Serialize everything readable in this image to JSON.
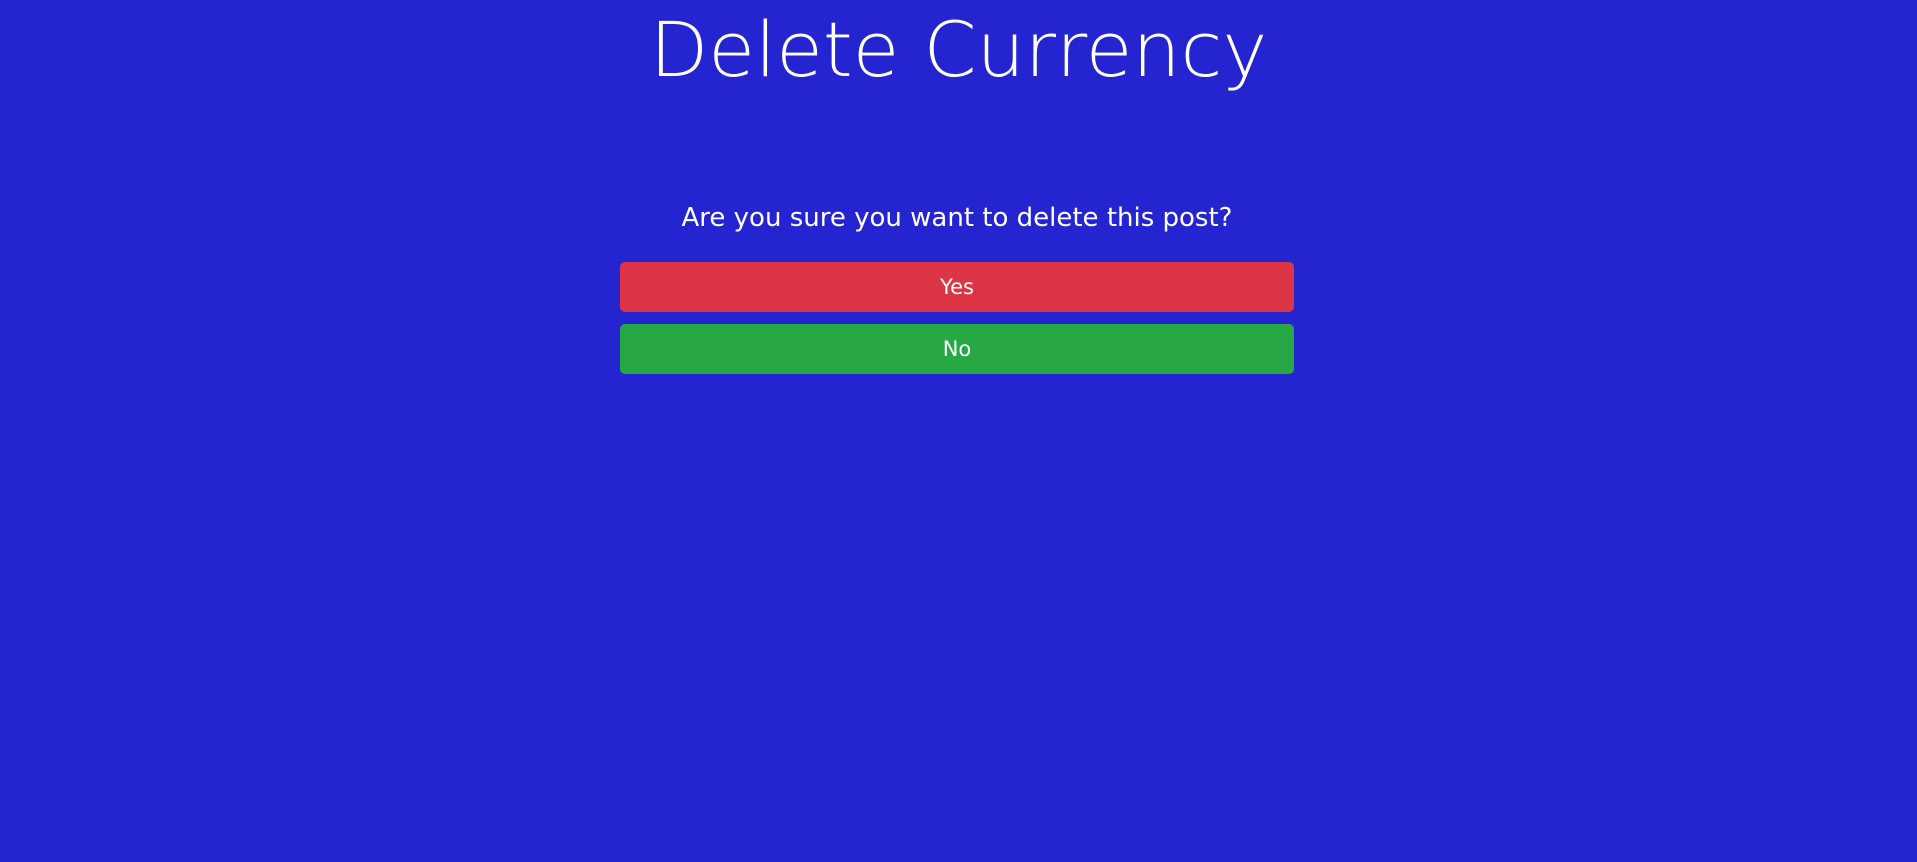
{
  "page": {
    "title": "Delete Currency",
    "background": "#2424d1"
  },
  "dialog": {
    "question": "Are you sure you want to delete this post?",
    "yes_label": "Yes",
    "no_label": "No",
    "yes_color": "#dc3545",
    "no_color": "#28a745"
  }
}
